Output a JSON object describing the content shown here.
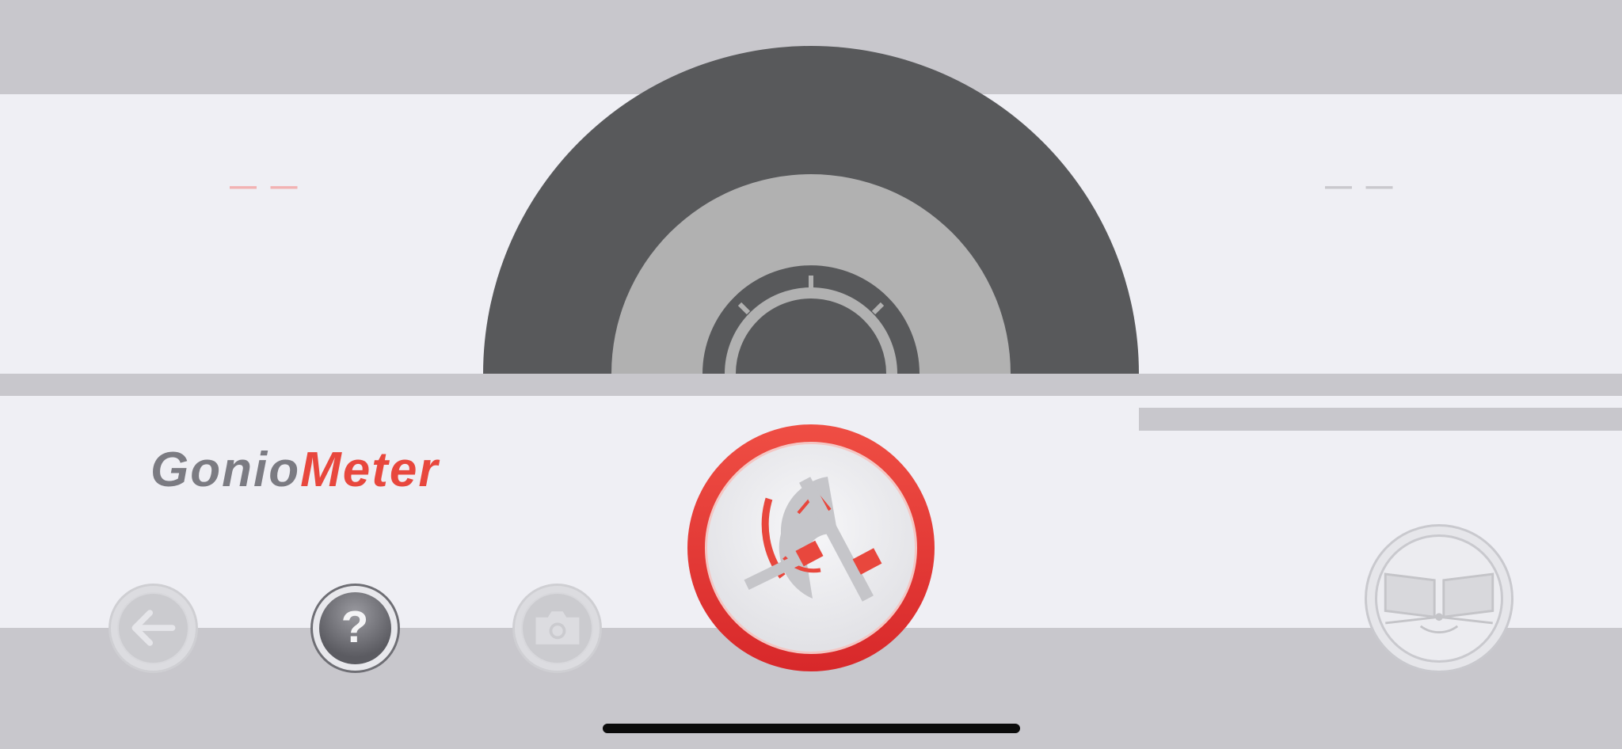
{
  "colors": {
    "background": "#c8c7cc",
    "panel": "#efeff4",
    "gauge_outer": "#58595b",
    "gauge_inner": "#b1b1b1",
    "accent_red": "#e8473d",
    "home_indicator": "#0b0b0b"
  },
  "readings": {
    "left": "— —",
    "right": "— —"
  },
  "logo": {
    "part1": "Gonio",
    "part2": "Meter"
  },
  "buttons": {
    "back_icon": "arrow-left-icon",
    "help_glyph": "?",
    "camera_icon": "camera-icon",
    "measure_icon": "goniometer-icon",
    "mirror_icon": "mirror-book-icon"
  }
}
